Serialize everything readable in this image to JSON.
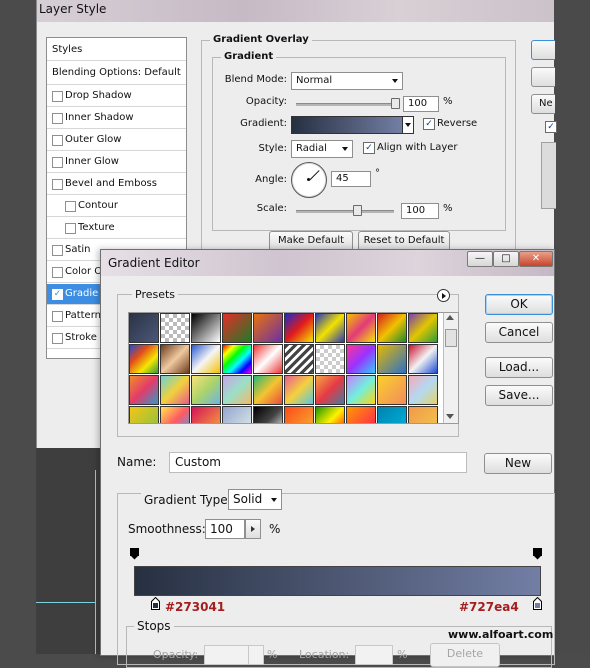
{
  "layer_style": {
    "title": "Layer Style",
    "styles_panel": {
      "header": "Styles",
      "blending": "Blending Options: Default",
      "items": [
        {
          "label": "Drop Shadow",
          "checked": false
        },
        {
          "label": "Inner Shadow",
          "checked": false
        },
        {
          "label": "Outer Glow",
          "checked": false
        },
        {
          "label": "Inner Glow",
          "checked": false
        },
        {
          "label": "Bevel and Emboss",
          "checked": false
        },
        {
          "label": "Contour",
          "checked": false
        },
        {
          "label": "Texture",
          "checked": false
        },
        {
          "label": "Satin",
          "checked": false
        },
        {
          "label": "Color O",
          "checked": false
        },
        {
          "label": "Gradie",
          "checked": true
        },
        {
          "label": "Pattern",
          "checked": false
        },
        {
          "label": "Stroke",
          "checked": false
        }
      ]
    },
    "gradient_overlay": {
      "group_title": "Gradient Overlay",
      "subgroup_title": "Gradient",
      "blend_mode_label": "Blend Mode:",
      "blend_mode": "Normal",
      "opacity_label": "Opacity:",
      "opacity": "100",
      "opacity_unit": "%",
      "gradient_label": "Gradient:",
      "reverse_label": "Reverse",
      "reverse_checked": true,
      "style_label": "Style:",
      "style": "Radial",
      "align_label": "Align with Layer",
      "align_checked": true,
      "angle_label": "Angle:",
      "angle": "45",
      "angle_unit": "°",
      "scale_label": "Scale:",
      "scale": "100",
      "scale_unit": "%",
      "make_default": "Make Default",
      "reset_default": "Reset to Default",
      "opacity_slider_level": 1.0,
      "scale_slider_level": 0.6
    },
    "right_buttons": {
      "new_partial": "Ne"
    }
  },
  "gradient_editor": {
    "title": "Gradient Editor",
    "window_buttons": {
      "minimize": "—",
      "maximize": "□",
      "close": "✕"
    },
    "presets_label": "Presets",
    "buttons": {
      "ok": "OK",
      "cancel": "Cancel",
      "load": "Load...",
      "save": "Save...",
      "new": "New"
    },
    "name_label": "Name:",
    "name_value": "Custom",
    "gradient_type_label": "Gradient Type:",
    "gradient_type": "Solid",
    "smoothness_label": "Smoothness:",
    "smoothness": "100",
    "smoothness_unit": "%",
    "stop_left_color": "#273041",
    "stop_right_color": "#727ea4",
    "stops_label": "Stops",
    "stops_opacity_label": "Opacity:",
    "stops_location_label": "Location:",
    "stops_unit": "%",
    "delete_label": "Delete",
    "watermark": "www.alfoart.com",
    "swatches": [
      "linear-gradient(135deg,#2b3346,#4b5877)",
      "repeating-conic-gradient(#bbb 0 25%,#fff 0 50%) 0 0/8px 8px",
      "linear-gradient(135deg,#000,#fff)",
      "linear-gradient(135deg,#e52d27,#1f7a2a)",
      "linear-gradient(135deg,#e8720c,#6b2fa8)",
      "linear-gradient(135deg,#1c2bc9,#e21b1b,#f6e600)",
      "linear-gradient(135deg,#2a3ab8,#f2e200,#2a3ab8)",
      "linear-gradient(135deg,#f2c200,#e23a7a,#f6e600)",
      "linear-gradient(135deg,#d62020,#f1c200,#1d8a2b)",
      "linear-gradient(135deg,#7a3fb3,#e2c600,#2e9c3a)",
      "linear-gradient(135deg,#1d4fd1,#e24b1b,#f6e600,#2e9c3a)",
      "linear-gradient(135deg,#6a3b1a,#f0c9a0,#6a3b1a)",
      "linear-gradient(135deg,#2a5bd0,#f5f5f5,#f4c000)",
      "linear-gradient(135deg,#f00,#ff0,#0f0,#0ff,#00f,#f0f)",
      "linear-gradient(135deg,#e33,#fff,#e33)",
      "repeating-linear-gradient(135deg,#444 0 3px,#fff 3px 6px)",
      "repeating-conic-gradient(#ccc 0 25%,#fff 0 50%) 0 0/8px 8px",
      "linear-gradient(135deg,#f39,#93f,#3cf)",
      "linear-gradient(135deg,#e6b800,#2b70c9)",
      "linear-gradient(135deg,#c8102e,#f2f2f2,#1c4bd1)",
      "linear-gradient(135deg,#f28c28,#e33b6b,#2e9ac9)",
      "linear-gradient(135deg,#6ad1d8,#f2d13c,#e85a8c)",
      "linear-gradient(135deg,#f9e27a,#a9d36a,#6fb3e6)",
      "linear-gradient(135deg,#c9a3e8,#9be0c6,#f4b86a)",
      "linear-gradient(135deg,#2bb673,#f4c430,#e94b3c)",
      "linear-gradient(135deg,#e95d8e,#f4d03f,#58c6e0)",
      "linear-gradient(135deg,#f4a742,#e63946,#457b9d)",
      "linear-gradient(135deg,#c77dff,#72efdd,#ffd60a)",
      "linear-gradient(135deg,#fad02c,#f38b5b)",
      "linear-gradient(135deg,#f7a8b8,#b3d9f2,#e6d36a)",
      "linear-gradient(135deg,#f5c518,#80c242)",
      "linear-gradient(135deg,#ffe74c,#ff5964,#35a7ff)",
      "linear-gradient(135deg,#d4145a,#fbb03b)",
      "linear-gradient(135deg,#93a5cf,#e4efe9)",
      "linear-gradient(135deg,#000,#434343,#fff)",
      "linear-gradient(135deg,#fc4a1a,#f7b733)",
      "linear-gradient(135deg,#1e9600,#fff200,#ff0000)",
      "linear-gradient(135deg,#ff9a00,#ff165d)",
      "linear-gradient(135deg,#0083b0,#00b4db)",
      "linear-gradient(135deg,#f2994a,#f2c94c)"
    ]
  }
}
